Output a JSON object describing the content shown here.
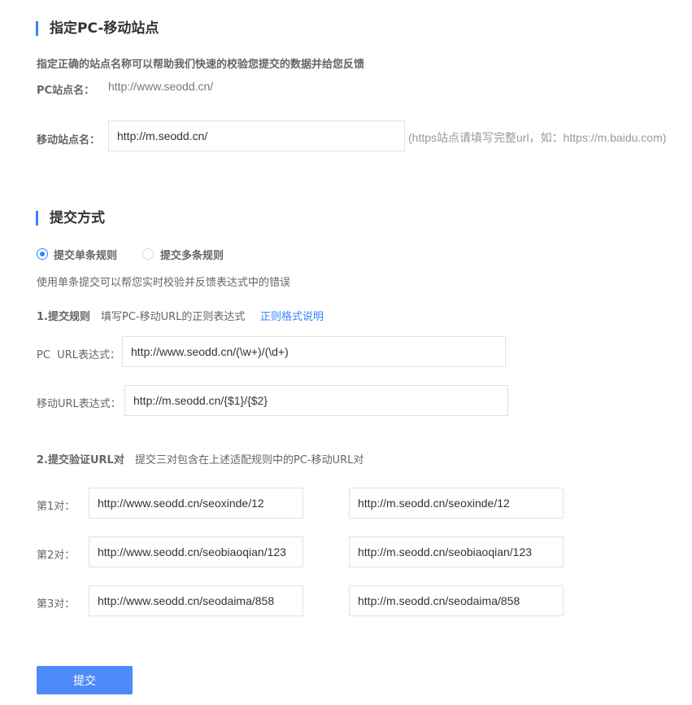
{
  "site": {
    "title": "指定PC-移动站点",
    "description": "指定正确的站点名称可以帮助我们快速的校验您提交的数据并给您反馈",
    "pc_label": "PC站点名：",
    "pc_value": "http://www.seodd.cn/",
    "mobile_label": "移动站点名：",
    "mobile_value": "http://m.seodd.cn/",
    "mobile_hint": "(https站点请填写完整url，如：https://m.baidu.com)"
  },
  "submit_method": {
    "title": "提交方式",
    "radio_single": "提交单条规则",
    "radio_multiple": "提交多条规则",
    "selected": "single",
    "description": "使用单条提交可以帮您实时校验并反馈表达式中的错误"
  },
  "rules": {
    "step_title": "1.提交规则",
    "step_desc": "填写PC-移动URL的正则表达式",
    "help_link": "正则格式说明",
    "pc_label": "PC  URL表达式：",
    "pc_value": "http://www.seodd.cn/(\\w+)/(\\d+)",
    "mobile_label": "移动URL表达式：",
    "mobile_value": "http://m.seodd.cn/{$1}/{$2}"
  },
  "pairs": {
    "step_title": "2.提交验证URL对",
    "step_desc": "提交三对包含在上述适配规则中的PC-移动URL对",
    "items": [
      {
        "label": "第1对：",
        "pc": "http://www.seodd.cn/seoxinde/12",
        "mobile": "http://m.seodd.cn/seoxinde/12"
      },
      {
        "label": "第2对：",
        "pc": "http://www.seodd.cn/seobiaoqian/123",
        "mobile": "http://m.seodd.cn/seobiaoqian/123"
      },
      {
        "label": "第3对：",
        "pc": "http://www.seodd.cn/seodaima/858",
        "mobile": "http://m.seodd.cn/seodaima/858"
      }
    ]
  },
  "submit_label": "提交",
  "colors": {
    "accent": "#3385ff",
    "button": "#4e8af9"
  }
}
